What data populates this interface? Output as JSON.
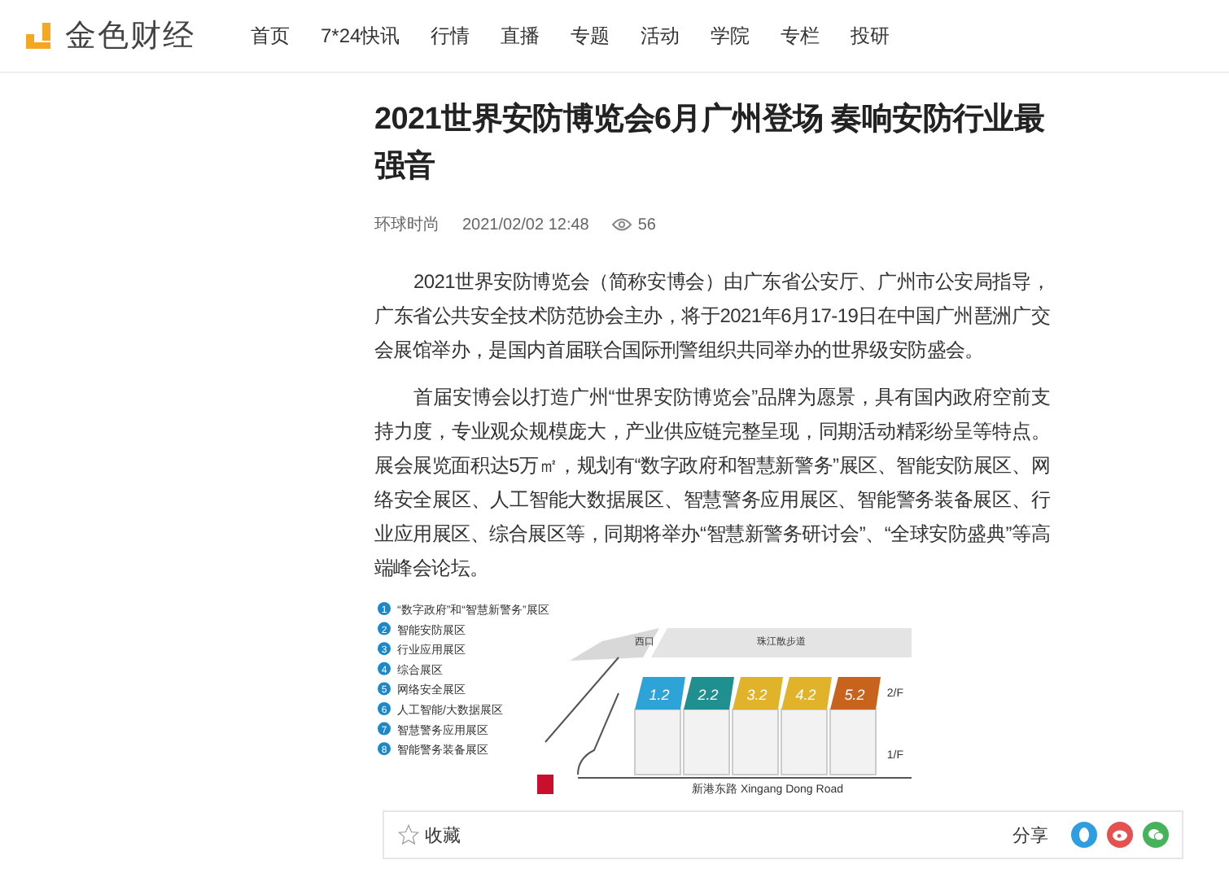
{
  "header": {
    "logo": "金色财经",
    "nav": [
      {
        "label": "首页",
        "selected": false
      },
      {
        "label": "7*24快讯",
        "selected": false
      },
      {
        "label": "行情",
        "selected": false
      },
      {
        "label": "直播",
        "selected": false
      },
      {
        "label": "专题",
        "selected": false
      },
      {
        "label": "活动",
        "selected": false
      },
      {
        "label": "学院",
        "selected": false
      },
      {
        "label": "专栏",
        "selected": false
      },
      {
        "label": "投研",
        "selected": false
      }
    ]
  },
  "article": {
    "title": "2021世界安防博览会6月广州登场 奏响安防行业最强音",
    "source": "环球时尚",
    "date": "2021/02/02 12:48",
    "views": "56",
    "paragraphs": [
      "2021世界安防博览会（简称安博会）由广东省公安厅、广州市公安局指导，广东省公共安全技术防范协会主办，将于2021年6月17-19日在中国广州琶洲广交会展馆举办，是国内首届联合国际刑警组织共同举办的世界级安防盛会。",
      "首届安博会以打造广州“世界安防博览会”品牌为愿景，具有国内政府空前支持力度，专业观众规模庞大，产业供应链完整呈现，同期活动精彩纷呈等特点。展会展览面积达5万㎡，规划有“数字政府和智慧新警务”展区、智能安防展区、网络安全展区、人工智能大数据展区、智慧警务应用展区、智能警务装备展区、行业应用展区、综合展区等，同期将举办“智慧新警务研讨会”、“全球安防盛典”等高端峰会论坛。"
    ],
    "floor_map": {
      "legend": [
        {
          "number": "1",
          "label": "“数字政府”和“智慧新警务”展区",
          "color": "#1a88c9"
        },
        {
          "number": "2",
          "label": "智能安防展区",
          "color": "#1a88c9"
        },
        {
          "number": "3",
          "label": "行业应用展区",
          "color": "#1a88c9"
        },
        {
          "number": "4",
          "label": "综合展区",
          "color": "#1a88c9"
        },
        {
          "number": "5",
          "label": "网络安全展区",
          "color": "#1a88c9"
        },
        {
          "number": "6",
          "label": "人工智能/大数据展区",
          "color": "#1a88c9"
        },
        {
          "number": "7",
          "label": "智慧警务应用展区",
          "color": "#1a88c9"
        },
        {
          "number": "8",
          "label": "智能警务装备展区",
          "color": "#1a88c9"
        }
      ],
      "halls": [
        {
          "label": "1.2",
          "color": "#2ea3d8"
        },
        {
          "label": "2.2",
          "color": "#1f8f8f"
        },
        {
          "label": "3.2",
          "color": "#e0b32a"
        },
        {
          "label": "4.2",
          "color": "#e0b32a"
        },
        {
          "label": "5.2",
          "color": "#c8631e"
        }
      ],
      "promenade": "珠江散步道",
      "west_gate": "西口",
      "road": "新港东路 Xingang Dong Road",
      "floors": [
        "2/F",
        "1/F"
      ]
    }
  },
  "action_bar": {
    "favorite": "收藏",
    "share": "分享"
  }
}
